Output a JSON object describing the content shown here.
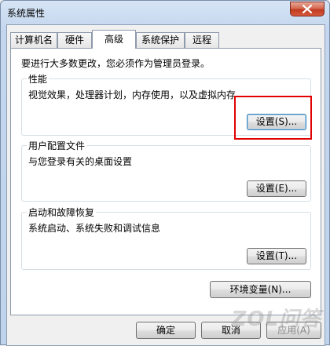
{
  "window": {
    "title": "系统属性"
  },
  "tabs": [
    {
      "label": "计算机名"
    },
    {
      "label": "硬件"
    },
    {
      "label": "高级"
    },
    {
      "label": "系统保护"
    },
    {
      "label": "远程"
    }
  ],
  "notice": "要进行大多数更改，您必须作为管理员登录。",
  "performance": {
    "title": "性能",
    "description": "视觉效果，处理器计划，内存使用，以及虚拟内存",
    "button": "设置(S)..."
  },
  "user_profiles": {
    "title": "用户配置文件",
    "description": "与您登录有关的桌面设置",
    "button": "设置(E)..."
  },
  "startup_recovery": {
    "title": "启动和故障恢复",
    "description": "系统启动、系统失败和调试信息",
    "button": "设置(T)..."
  },
  "env_button": "环境变量(N)...",
  "footer": {
    "ok": "确定",
    "cancel": "取消",
    "apply": "应用(A)"
  },
  "watermark": "ZOL问答",
  "colors": {
    "highlight": "#e00000",
    "close_button": "#c1391f"
  }
}
